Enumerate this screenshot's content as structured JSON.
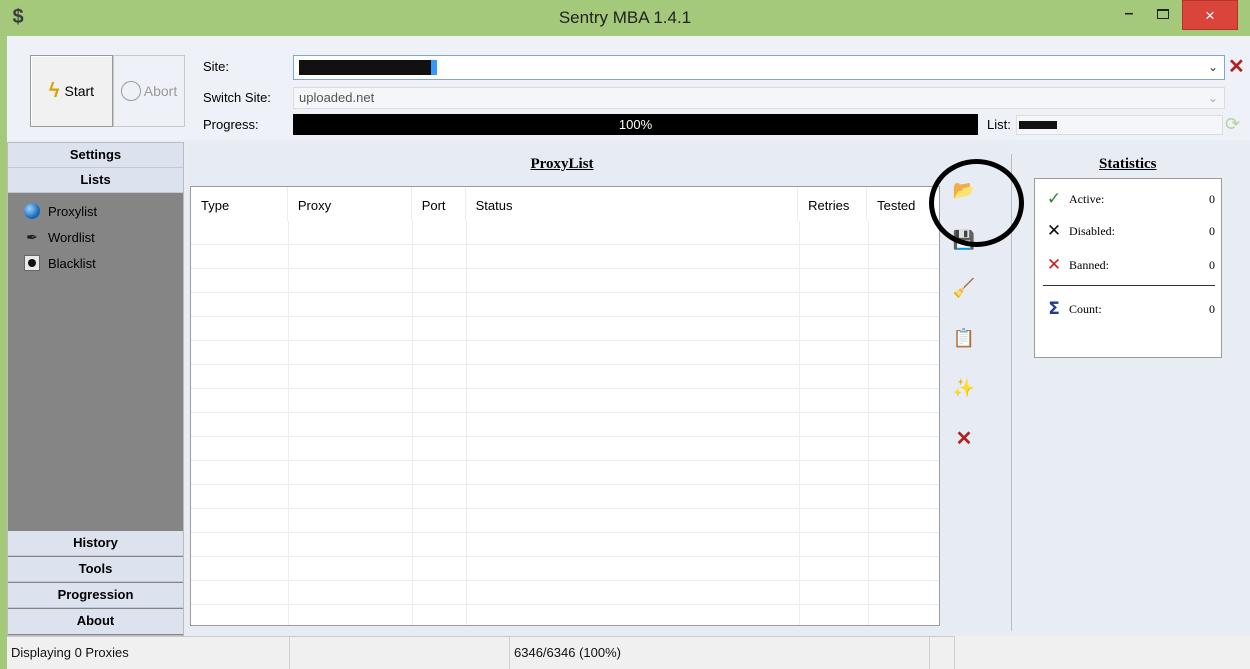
{
  "window": {
    "icon": "dollar-sign-icon",
    "title": "Sentry MBA 1.4.1",
    "minimize": "–",
    "close": "×"
  },
  "top": {
    "start_label": "Start",
    "abort_label": "Abort",
    "site_label": "Site:",
    "switch_label": "Switch Site:",
    "switch_value": "uploaded.net",
    "progress_label": "Progress:",
    "progress_value": "100%",
    "list_label": "List:"
  },
  "nav": {
    "settings": "Settings",
    "lists": "Lists",
    "items": [
      {
        "label": "Proxylist",
        "icon": "globe-icon"
      },
      {
        "label": "Wordlist",
        "icon": "quill-icon"
      },
      {
        "label": "Blacklist",
        "icon": "blacklist-icon"
      }
    ],
    "history": "History",
    "tools": "Tools",
    "progression": "Progression",
    "about": "About"
  },
  "proxylist": {
    "title": "ProxyList",
    "columns": [
      "Type",
      "Proxy",
      "Port",
      "Status",
      "Retries",
      "Tested"
    ],
    "rows": []
  },
  "toolbar": {
    "icons": [
      "open-folder-icon",
      "save-disk-icon",
      "broom-icon",
      "clipboard-paste-icon",
      "magic-wand-icon",
      "delete-icon"
    ]
  },
  "statistics": {
    "title": "Statistics",
    "rows": [
      {
        "label": "Active:",
        "value": "0",
        "icon": "checkmark-icon"
      },
      {
        "label": "Disabled:",
        "value": "0",
        "icon": "x-icon"
      },
      {
        "label": "Banned:",
        "value": "0",
        "icon": "red-x-icon"
      },
      {
        "label": "Count:",
        "value": "0",
        "icon": "sigma-icon"
      }
    ]
  },
  "status": {
    "left": "Displaying 0 Proxies",
    "middle": "6346/6346 (100%)"
  },
  "colors": {
    "frame": "#a4c97a",
    "close_button": "#d9453a",
    "nav_background": "#858585"
  }
}
